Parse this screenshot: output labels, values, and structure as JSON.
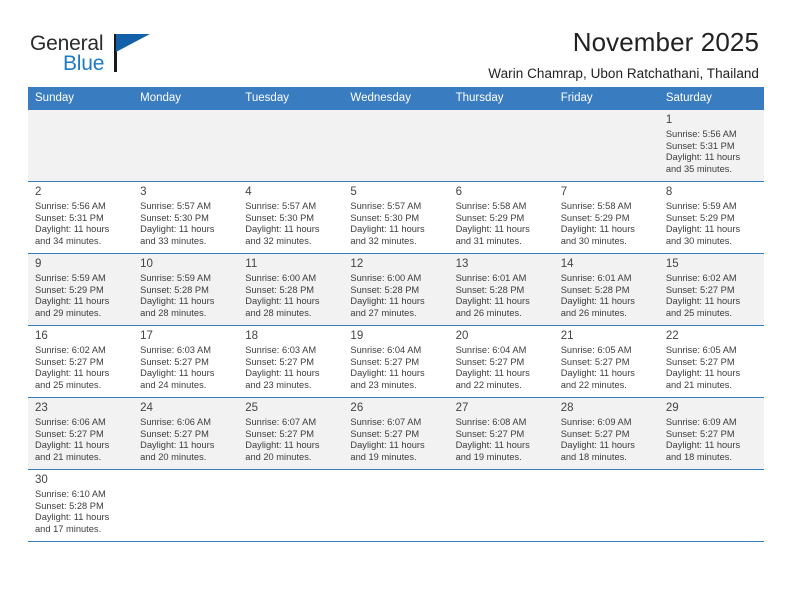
{
  "brand": {
    "name_top": "General",
    "name_bottom": "Blue",
    "flag_icon": "triangle-flag-icon",
    "accent_color": "#1d7bc4",
    "header_color": "#3a7cc0"
  },
  "header": {
    "title": "November 2025",
    "subtitle": "Warin Chamrap, Ubon Ratchathani, Thailand"
  },
  "calendar": {
    "weekday_headers": [
      "Sunday",
      "Monday",
      "Tuesday",
      "Wednesday",
      "Thursday",
      "Friday",
      "Saturday"
    ],
    "weeks": [
      [
        {
          "day": "",
          "info": ""
        },
        {
          "day": "",
          "info": ""
        },
        {
          "day": "",
          "info": ""
        },
        {
          "day": "",
          "info": ""
        },
        {
          "day": "",
          "info": ""
        },
        {
          "day": "",
          "info": ""
        },
        {
          "day": "1",
          "info": "Sunrise: 5:56 AM\nSunset: 5:31 PM\nDaylight: 11 hours\nand 35 minutes."
        }
      ],
      [
        {
          "day": "2",
          "info": "Sunrise: 5:56 AM\nSunset: 5:31 PM\nDaylight: 11 hours\nand 34 minutes."
        },
        {
          "day": "3",
          "info": "Sunrise: 5:57 AM\nSunset: 5:30 PM\nDaylight: 11 hours\nand 33 minutes."
        },
        {
          "day": "4",
          "info": "Sunrise: 5:57 AM\nSunset: 5:30 PM\nDaylight: 11 hours\nand 32 minutes."
        },
        {
          "day": "5",
          "info": "Sunrise: 5:57 AM\nSunset: 5:30 PM\nDaylight: 11 hours\nand 32 minutes."
        },
        {
          "day": "6",
          "info": "Sunrise: 5:58 AM\nSunset: 5:29 PM\nDaylight: 11 hours\nand 31 minutes."
        },
        {
          "day": "7",
          "info": "Sunrise: 5:58 AM\nSunset: 5:29 PM\nDaylight: 11 hours\nand 30 minutes."
        },
        {
          "day": "8",
          "info": "Sunrise: 5:59 AM\nSunset: 5:29 PM\nDaylight: 11 hours\nand 30 minutes."
        }
      ],
      [
        {
          "day": "9",
          "info": "Sunrise: 5:59 AM\nSunset: 5:29 PM\nDaylight: 11 hours\nand 29 minutes."
        },
        {
          "day": "10",
          "info": "Sunrise: 5:59 AM\nSunset: 5:28 PM\nDaylight: 11 hours\nand 28 minutes."
        },
        {
          "day": "11",
          "info": "Sunrise: 6:00 AM\nSunset: 5:28 PM\nDaylight: 11 hours\nand 28 minutes."
        },
        {
          "day": "12",
          "info": "Sunrise: 6:00 AM\nSunset: 5:28 PM\nDaylight: 11 hours\nand 27 minutes."
        },
        {
          "day": "13",
          "info": "Sunrise: 6:01 AM\nSunset: 5:28 PM\nDaylight: 11 hours\nand 26 minutes."
        },
        {
          "day": "14",
          "info": "Sunrise: 6:01 AM\nSunset: 5:28 PM\nDaylight: 11 hours\nand 26 minutes."
        },
        {
          "day": "15",
          "info": "Sunrise: 6:02 AM\nSunset: 5:27 PM\nDaylight: 11 hours\nand 25 minutes."
        }
      ],
      [
        {
          "day": "16",
          "info": "Sunrise: 6:02 AM\nSunset: 5:27 PM\nDaylight: 11 hours\nand 25 minutes."
        },
        {
          "day": "17",
          "info": "Sunrise: 6:03 AM\nSunset: 5:27 PM\nDaylight: 11 hours\nand 24 minutes."
        },
        {
          "day": "18",
          "info": "Sunrise: 6:03 AM\nSunset: 5:27 PM\nDaylight: 11 hours\nand 23 minutes."
        },
        {
          "day": "19",
          "info": "Sunrise: 6:04 AM\nSunset: 5:27 PM\nDaylight: 11 hours\nand 23 minutes."
        },
        {
          "day": "20",
          "info": "Sunrise: 6:04 AM\nSunset: 5:27 PM\nDaylight: 11 hours\nand 22 minutes."
        },
        {
          "day": "21",
          "info": "Sunrise: 6:05 AM\nSunset: 5:27 PM\nDaylight: 11 hours\nand 22 minutes."
        },
        {
          "day": "22",
          "info": "Sunrise: 6:05 AM\nSunset: 5:27 PM\nDaylight: 11 hours\nand 21 minutes."
        }
      ],
      [
        {
          "day": "23",
          "info": "Sunrise: 6:06 AM\nSunset: 5:27 PM\nDaylight: 11 hours\nand 21 minutes."
        },
        {
          "day": "24",
          "info": "Sunrise: 6:06 AM\nSunset: 5:27 PM\nDaylight: 11 hours\nand 20 minutes."
        },
        {
          "day": "25",
          "info": "Sunrise: 6:07 AM\nSunset: 5:27 PM\nDaylight: 11 hours\nand 20 minutes."
        },
        {
          "day": "26",
          "info": "Sunrise: 6:07 AM\nSunset: 5:27 PM\nDaylight: 11 hours\nand 19 minutes."
        },
        {
          "day": "27",
          "info": "Sunrise: 6:08 AM\nSunset: 5:27 PM\nDaylight: 11 hours\nand 19 minutes."
        },
        {
          "day": "28",
          "info": "Sunrise: 6:09 AM\nSunset: 5:27 PM\nDaylight: 11 hours\nand 18 minutes."
        },
        {
          "day": "29",
          "info": "Sunrise: 6:09 AM\nSunset: 5:27 PM\nDaylight: 11 hours\nand 18 minutes."
        }
      ],
      [
        {
          "day": "30",
          "info": "Sunrise: 6:10 AM\nSunset: 5:28 PM\nDaylight: 11 hours\nand 17 minutes."
        },
        {
          "day": "",
          "info": ""
        },
        {
          "day": "",
          "info": ""
        },
        {
          "day": "",
          "info": ""
        },
        {
          "day": "",
          "info": ""
        },
        {
          "day": "",
          "info": ""
        },
        {
          "day": "",
          "info": ""
        }
      ]
    ]
  }
}
